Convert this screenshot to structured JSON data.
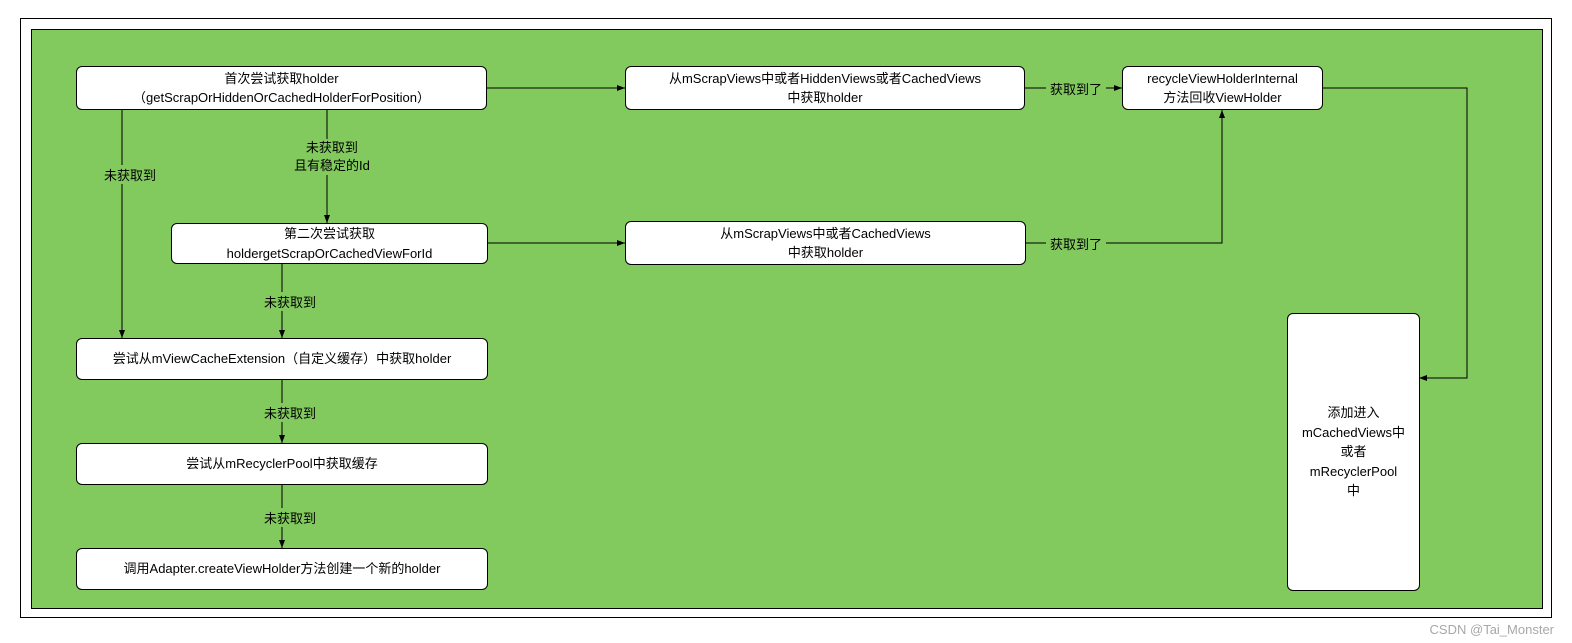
{
  "watermark": "CSDN @Tai_Monster",
  "nodes": {
    "a": {
      "line1": "首次尝试获取holder",
      "line2": "（getScrapOrHiddenOrCachedHolderForPosition）"
    },
    "b": {
      "line1": "从mScrapViews中或者HiddenViews或者CachedViews",
      "line2": "中获取holder"
    },
    "c": {
      "line1": "recycleViewHolderInternal",
      "line2": "方法回收ViewHolder"
    },
    "d": {
      "line1": "第二次尝试获取holdergetScrapOrCachedViewForId"
    },
    "e": {
      "line1": "从mScrapViews中或者CachedViews",
      "line2": "中获取holder"
    },
    "f": {
      "line1": "尝试从mViewCacheExtension（自定义缓存）中获取holder"
    },
    "g": {
      "line1": "尝试从mRecyclerPool中获取缓存"
    },
    "h": {
      "line1": "调用Adapter.createViewHolder方法创建一个新的holder"
    },
    "i": {
      "line1": "添加进入",
      "line2": "mCachedViews中",
      "line3": "或者mRecyclerPool",
      "line4": "中"
    }
  },
  "labels": {
    "l1": "获取到了",
    "l2": "未获取到\n且有稳定的Id",
    "l3": "未获取到",
    "l4": "获取到了",
    "l5": "未获取到",
    "l6": "未获取到",
    "l7": "未获取到"
  }
}
